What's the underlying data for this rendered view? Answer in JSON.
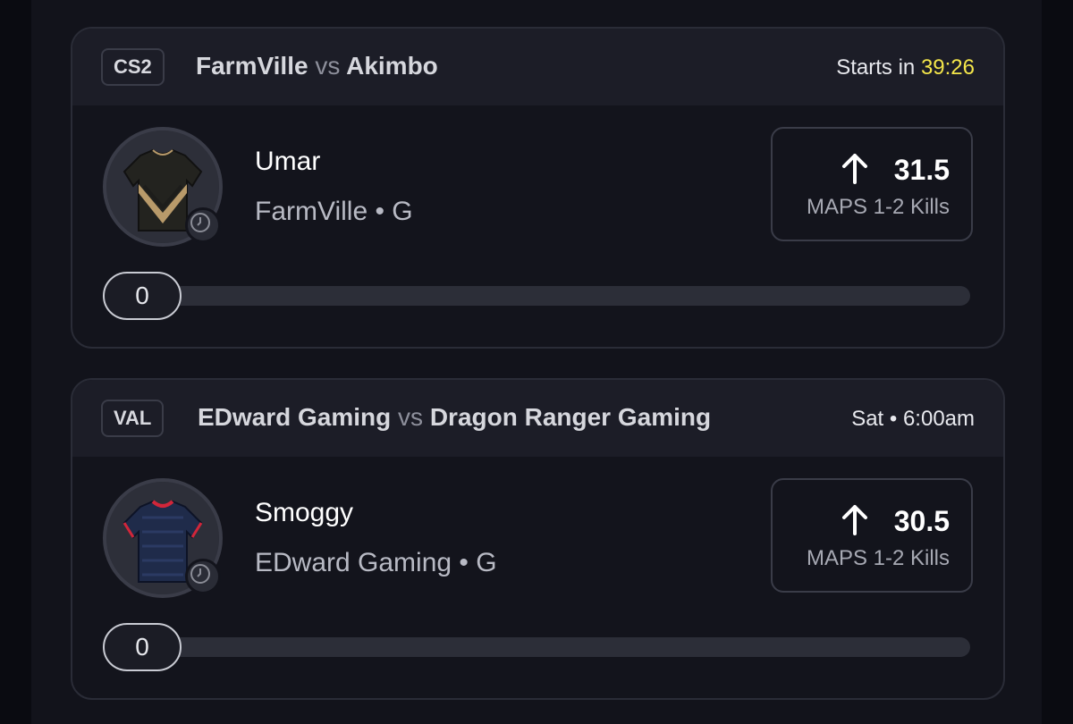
{
  "cards": [
    {
      "game": "CS2",
      "team_a": "FarmVille",
      "vs": "vs",
      "team_b": "Akimbo",
      "start_prefix": "Starts in",
      "start_countdown": "39:26",
      "countdown_color": "#f4e64a",
      "player": "Umar",
      "team_position": "FarmVille • G",
      "line": "31.5",
      "direction_icon": "arrow-up-icon",
      "stat": "MAPS 1-2 Kills",
      "progress": "0",
      "jersey_icon": "black-gold-jersey"
    },
    {
      "game": "VAL",
      "team_a": "EDward Gaming",
      "vs": "vs",
      "team_b": "Dragon Ranger Gaming",
      "start_time": "Sat • 6:00am",
      "player": "Smoggy",
      "team_position": "EDward Gaming • G",
      "line": "30.5",
      "direction_icon": "arrow-up-icon",
      "stat": "MAPS 1-2 Kills",
      "progress": "0",
      "jersey_icon": "navy-red-jersey"
    }
  ]
}
